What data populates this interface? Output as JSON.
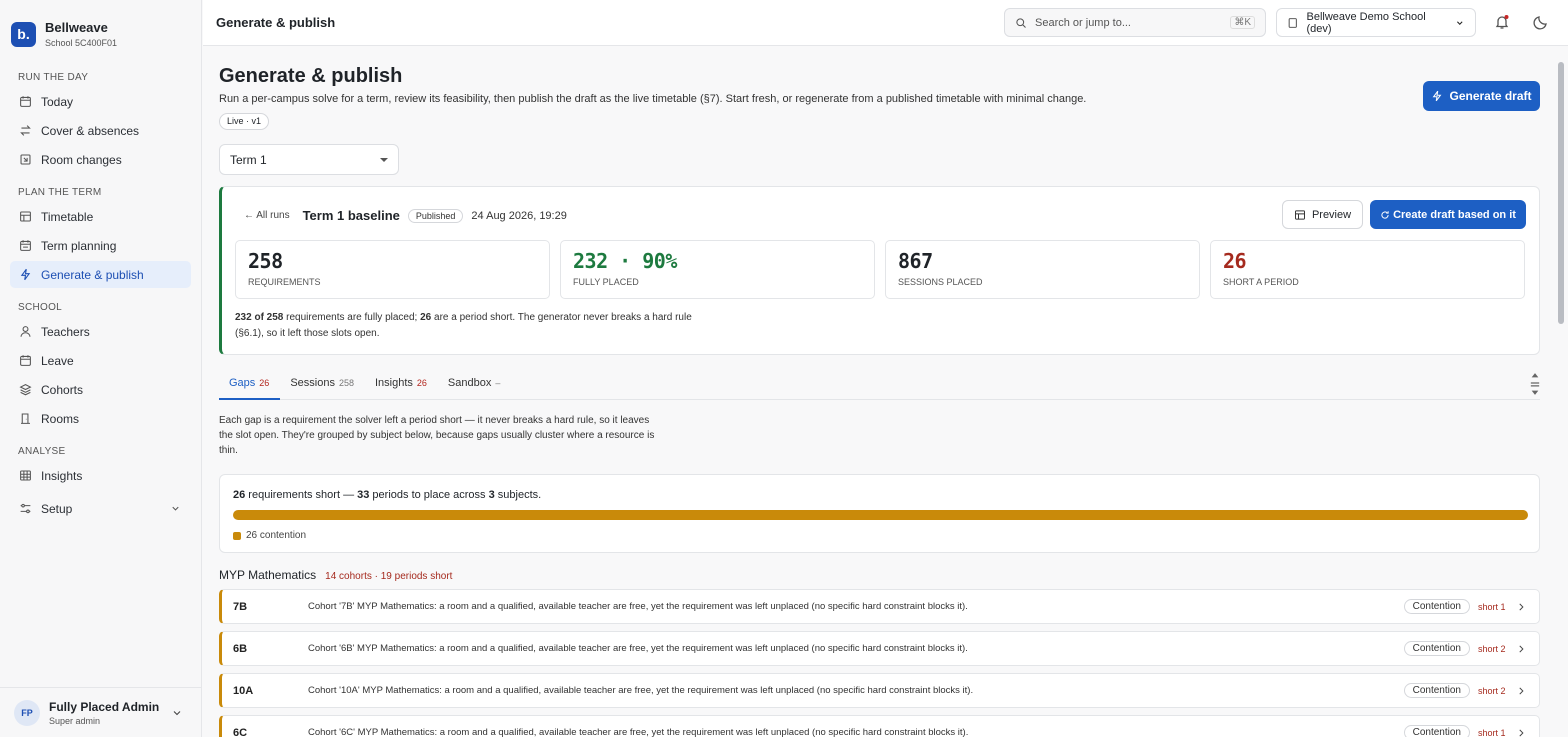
{
  "brand": {
    "logo_letter": "b.",
    "name": "Bellweave",
    "school_id": "School 5C400F01"
  },
  "sidebar": {
    "sections": [
      {
        "label": "RUN THE DAY",
        "items": [
          {
            "label": "Today",
            "icon": "calendar-icon"
          },
          {
            "label": "Cover & absences",
            "icon": "swap-icon"
          },
          {
            "label": "Room changes",
            "icon": "door-icon"
          }
        ]
      },
      {
        "label": "PLAN THE TERM",
        "items": [
          {
            "label": "Timetable",
            "icon": "grid-icon"
          },
          {
            "label": "Term planning",
            "icon": "calendar-range-icon"
          },
          {
            "label": "Generate & publish",
            "icon": "bolt-icon",
            "active": true
          }
        ]
      },
      {
        "label": "SCHOOL",
        "items": [
          {
            "label": "Teachers",
            "icon": "person-icon"
          },
          {
            "label": "Leave",
            "icon": "calendar-icon"
          },
          {
            "label": "Cohorts",
            "icon": "layers-icon"
          },
          {
            "label": "Rooms",
            "icon": "door-icon"
          }
        ]
      },
      {
        "label": "ANALYSE",
        "items": [
          {
            "label": "Insights",
            "icon": "grid-icon"
          },
          {
            "label": "Setup",
            "icon": "sliders-icon",
            "expandable": true
          }
        ]
      }
    ],
    "user": {
      "initials": "FP",
      "name": "Fully Placed Admin",
      "role": "Super admin"
    }
  },
  "topbar": {
    "title": "Generate & publish",
    "search_placeholder": "Search or jump to...",
    "search_shortcut": "⌘K",
    "school_select": "Bellweave Demo School (dev)"
  },
  "page": {
    "title": "Generate & publish",
    "description": "Run a per-campus solve for a term, review its feasibility, then publish the draft as the live timetable (§7). Start fresh, or regenerate from a published timetable with minimal change.",
    "live_chip": "Live · v1",
    "generate_button": "Generate draft",
    "term_select": "Term 1"
  },
  "run": {
    "back_link": "← All runs",
    "name": "Term 1 baseline",
    "status_chip": "Published",
    "date": "24 Aug 2026, 19:29",
    "preview_button": "Preview",
    "draft_button": "Create draft based on it",
    "stats": [
      {
        "value": "258",
        "label": "REQUIREMENTS",
        "color": "#1f2328"
      },
      {
        "value": "232 · 90%",
        "label": "FULLY PLACED",
        "color": "#1d7a3f"
      },
      {
        "value": "867",
        "label": "SESSIONS PLACED",
        "color": "#1f2328"
      },
      {
        "value": "26",
        "label": "SHORT A PERIOD",
        "color": "#a52a1e"
      }
    ],
    "note_placed": "232 of 258",
    "note_mid": " requirements are fully placed; ",
    "note_short": "26",
    "note_end": " are a period short. The generator never breaks a hard rule (§6.1), so it left those slots open."
  },
  "tabs": [
    {
      "label": "Gaps",
      "count": "26",
      "active": true,
      "count_color": "red"
    },
    {
      "label": "Sessions",
      "count": "258"
    },
    {
      "label": "Insights",
      "count": "26",
      "count_color": "red"
    },
    {
      "label": "Sandbox",
      "count": "–"
    }
  ],
  "gaps": {
    "description": "Each gap is a requirement the solver left a period short — it never breaks a hard rule, so it leaves the slot open. They're grouped by subject below, because gaps usually cluster where a resource is thin.",
    "summary": {
      "count": "26",
      "text1": " requirements short — ",
      "periods": "33",
      "text2": " periods to place across ",
      "subjects": "3",
      "text3": " subjects."
    },
    "legend": "26 contention",
    "bar_fraction": 1.0,
    "group": {
      "name": "MYP Mathematics",
      "meta": "14 cohorts · 19 periods short"
    },
    "rows": [
      {
        "cohort": "7B",
        "text": "Cohort '7B' MYP Mathematics: a room and a qualified, available teacher are free, yet the requirement was left unplaced (no specific hard constraint blocks it).",
        "chip": "Contention",
        "short": "short 1"
      },
      {
        "cohort": "6B",
        "text": "Cohort '6B' MYP Mathematics: a room and a qualified, available teacher are free, yet the requirement was left unplaced (no specific hard constraint blocks it).",
        "chip": "Contention",
        "short": "short 2"
      },
      {
        "cohort": "10A",
        "text": "Cohort '10A' MYP Mathematics: a room and a qualified, available teacher are free, yet the requirement was left unplaced (no specific hard constraint blocks it).",
        "chip": "Contention",
        "short": "short 2"
      },
      {
        "cohort": "6C",
        "text": "Cohort '6C' MYP Mathematics: a room and a qualified, available teacher are free, yet the requirement was left unplaced (no specific hard constraint blocks it).",
        "chip": "Contention",
        "short": "short 1"
      }
    ]
  }
}
